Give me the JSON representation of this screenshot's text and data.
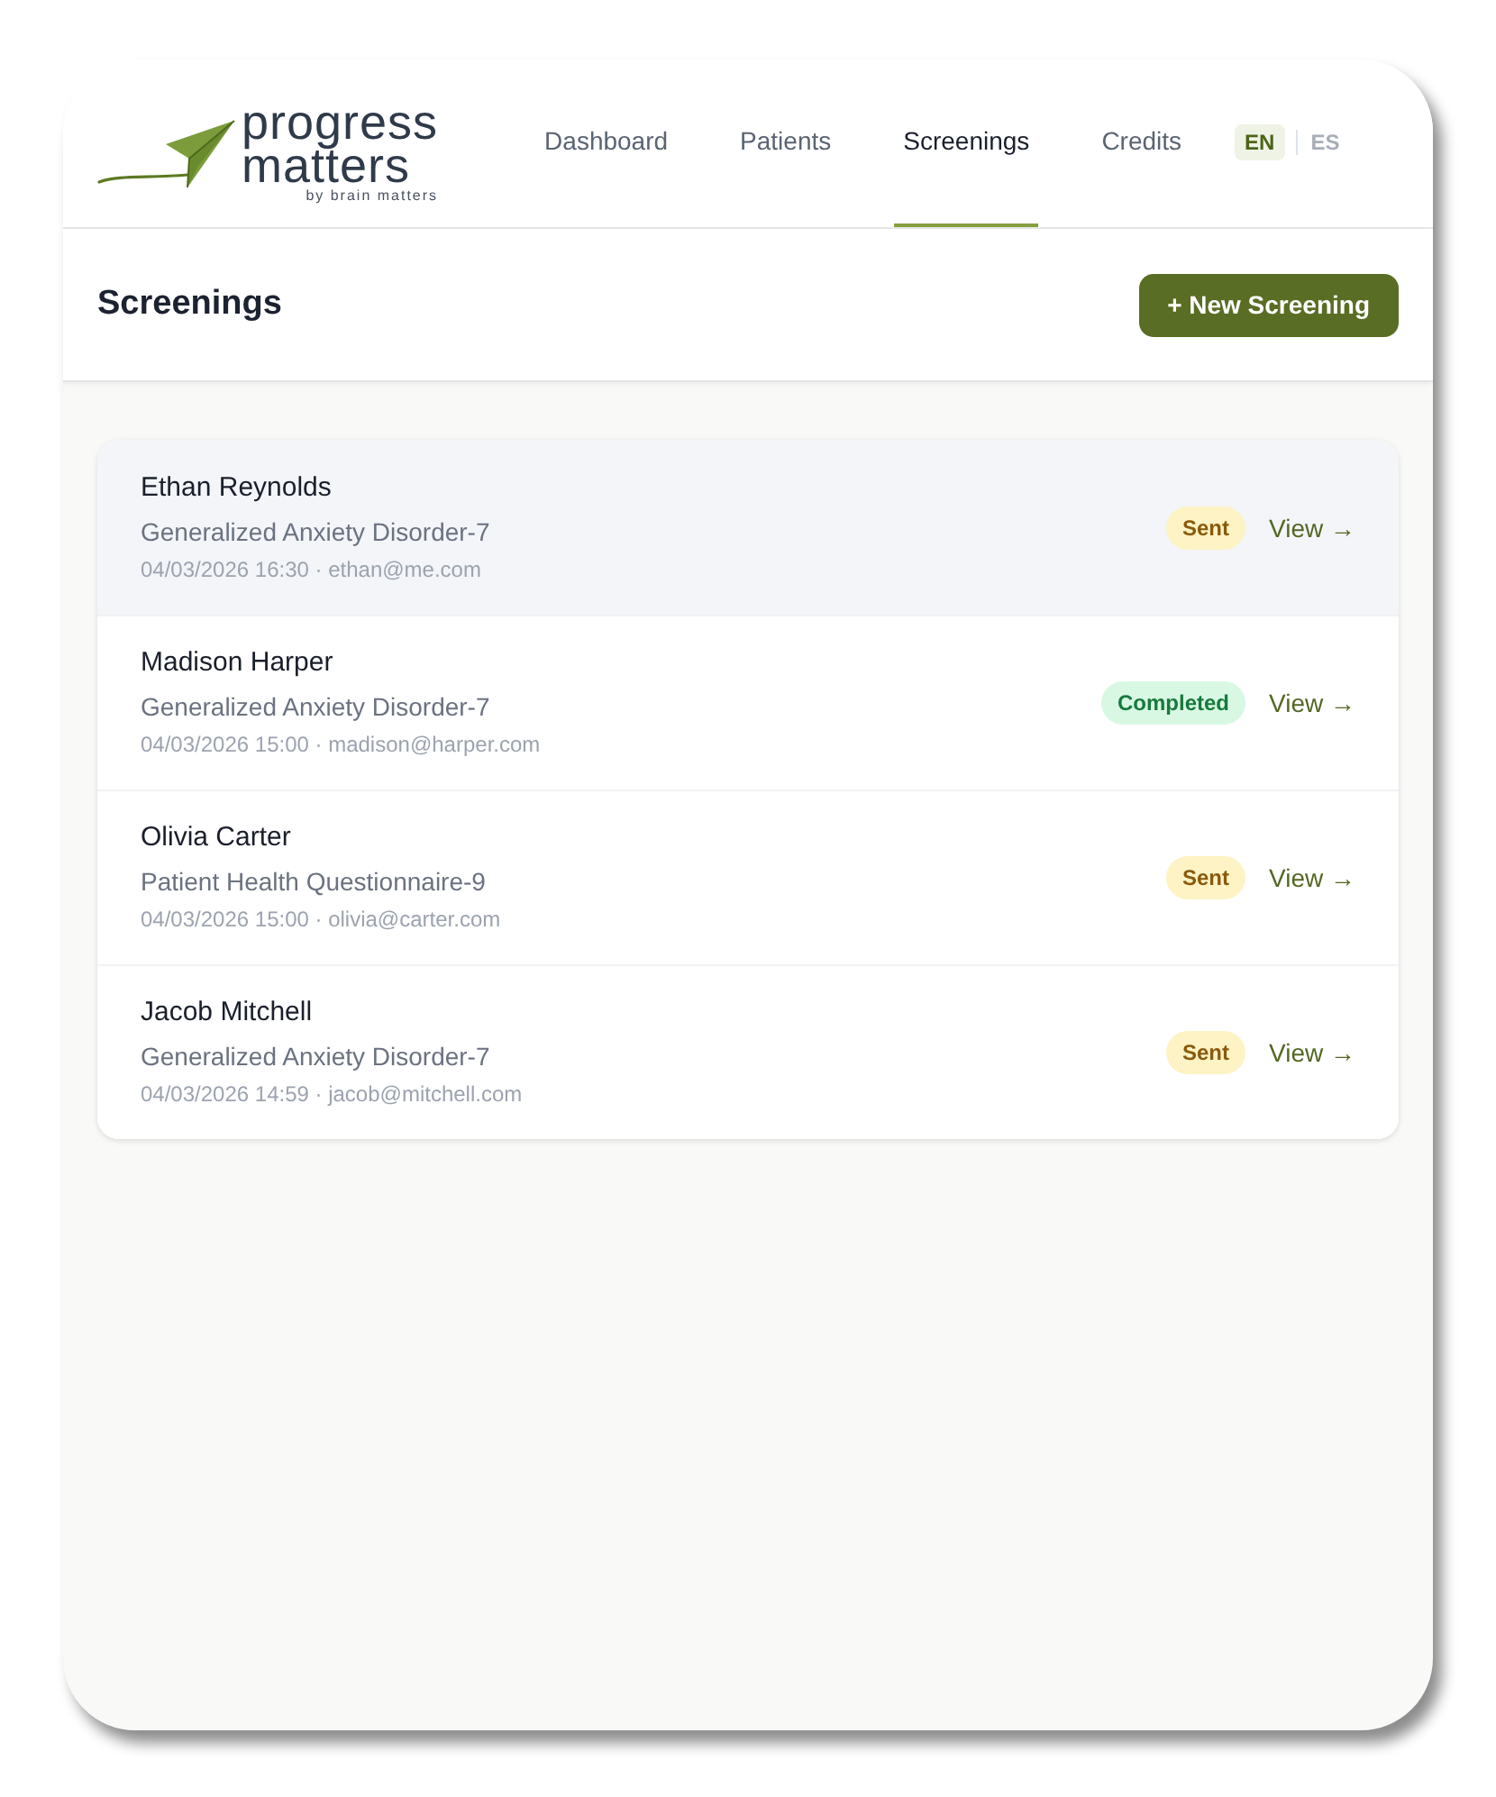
{
  "logo": {
    "wordmark": [
      "progress",
      "matters"
    ],
    "tagline": "by brain matters"
  },
  "nav": {
    "tabs": [
      {
        "label": "Dashboard",
        "selected": false
      },
      {
        "label": "Patients",
        "selected": false
      },
      {
        "label": "Screenings",
        "selected": true
      },
      {
        "label": "Credits",
        "selected": false
      }
    ],
    "languages": [
      {
        "label": "EN",
        "selected": true
      },
      {
        "label": "ES",
        "selected": false
      }
    ]
  },
  "page": {
    "title": "Screenings",
    "action": "+ New Screening"
  },
  "screenings": [
    {
      "name": "Ethan Reynolds",
      "test": "Generalized Anxiety Disorder-7",
      "meta": "04/03/2026 16:30 · ethan@me.com",
      "status": {
        "kind": "sent",
        "label": "Sent"
      },
      "link": "View →",
      "highlighted": true
    },
    {
      "name": "Madison Harper",
      "test": "Generalized Anxiety Disorder-7",
      "meta": "04/03/2026 15:00 · madison@harper.com",
      "status": {
        "kind": "completed",
        "label": "Completed"
      },
      "link": "View →",
      "highlighted": false
    },
    {
      "name": "Olivia Carter",
      "test": "Patient Health Questionnaire-9",
      "meta": "04/03/2026 15:00 · olivia@carter.com",
      "status": {
        "kind": "sent",
        "label": "Sent"
      },
      "link": "View →",
      "highlighted": false
    },
    {
      "name": "Jacob Mitchell",
      "test": "Generalized Anxiety Disorder-7",
      "meta": "04/03/2026 14:59 · jacob@mitchell.com",
      "status": {
        "kind": "sent",
        "label": "Sent"
      },
      "link": "View →",
      "highlighted": false
    }
  ]
}
